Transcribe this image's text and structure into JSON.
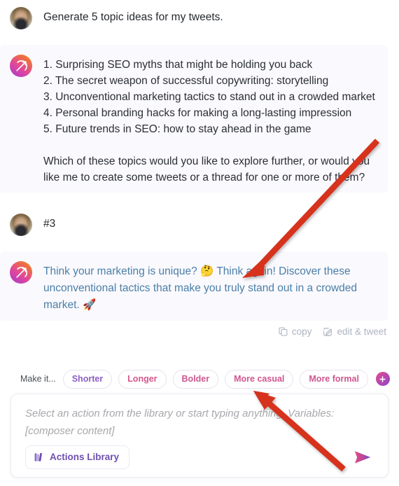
{
  "messages": [
    {
      "role": "user",
      "avatar": "user-photo-avatar",
      "text": "Generate 5 topic ideas for my tweets."
    },
    {
      "role": "assistant",
      "avatar": "ai-gradient-avatar",
      "text": "1. Surprising SEO myths that might be holding you back\n2. The secret weapon of successful copywriting: storytelling\n3. Unconventional marketing tactics to stand out in a crowded market\n4. Personal branding hacks for making a long-lasting impression\n5. Future trends in SEO: how to stay ahead in the game\n\nWhich of these topics would you like to explore further, or would you like me to create some tweets or a thread for one or more of them?"
    },
    {
      "role": "user",
      "avatar": "user-photo-avatar",
      "text": "#3"
    },
    {
      "role": "assistant",
      "avatar": "ai-gradient-avatar",
      "text": "Think your marketing is unique? 🤔 Think again! Discover these unconventional tactics that make you truly stand out in a crowded market. 🚀"
    }
  ],
  "message_actions": {
    "copy_label": "copy",
    "copy_icon": "copy-icon",
    "edit_tweet_label": "edit & tweet",
    "edit_tweet_icon": "edit-pencil-icon"
  },
  "make_it": {
    "label": "Make it...",
    "pills": [
      {
        "label": "Shorter",
        "color": "#8b5fc4"
      },
      {
        "label": "Longer",
        "color": "#d3568c"
      },
      {
        "label": "Bolder",
        "color": "#cf5690"
      },
      {
        "label": "More casual",
        "color": "#cf5690"
      },
      {
        "label": "More formal",
        "color": "#cf5690"
      }
    ],
    "add_button_icon": "plus-icon"
  },
  "composer": {
    "placeholder": "Select an action from the library or start typing anything. Variables: [composer content]",
    "value": "",
    "actions_library_label": "Actions Library",
    "actions_library_icon": "library-books-icon",
    "send_icon": "send-paper-plane-icon"
  },
  "theme": {
    "ai_bubble_bg": "#faf9fd",
    "tweet_text_color": "#4a7fa8",
    "accent_pink": "#e34b8f",
    "accent_purple": "#8e45c8",
    "annotation_arrow_color": "#d6301f"
  },
  "annotations": [
    {
      "name": "arrow-to-tweet-message",
      "color": "#d6301f"
    },
    {
      "name": "arrow-to-more-casual-pill",
      "color": "#d6301f"
    }
  ]
}
